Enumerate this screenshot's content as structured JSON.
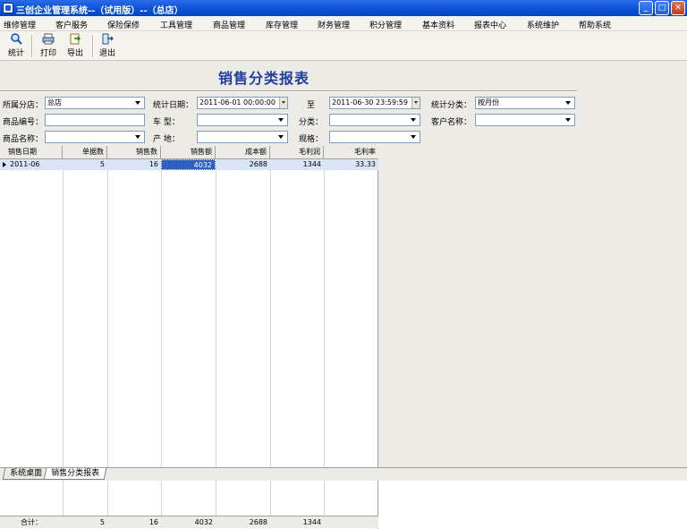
{
  "window": {
    "title": "三创企业管理系统--（试用版）--（总店）",
    "minimize": "_",
    "maximize": "□",
    "close": "✕"
  },
  "menu": [
    "维修管理",
    "客户服务",
    "保险保修",
    "工具管理",
    "商品管理",
    "库存管理",
    "财务管理",
    "积分管理",
    "基本资料",
    "报表中心",
    "系统维护",
    "帮助系统"
  ],
  "toolbar": {
    "stat": "统计",
    "print": "打印",
    "export": "导出",
    "exit": "退出"
  },
  "report": {
    "title": "销售分类报表"
  },
  "filters": {
    "branch_label": "所属分店：",
    "branch_value": "总店",
    "date_label": "统计日期：",
    "date_from": "2011-06-01 00:00:00",
    "to_label": "至",
    "date_to": "2011-06-30 23:59:59",
    "stat_type_label": "统计分类：",
    "stat_type_value": "按月份",
    "product_code_label": "商品编号：",
    "product_code_value": "",
    "car_label": "车    型：",
    "car_value": "",
    "category_label": "分类：",
    "category_value": "",
    "customer_label": "客户名称：",
    "customer_value": "",
    "product_name_label": "商品名称：",
    "product_name_value": "",
    "origin_label": "产    地：",
    "origin_value": "",
    "spec_label": "规格：",
    "spec_value": ""
  },
  "table": {
    "headers": [
      "销售日期",
      "单据数",
      "销售数",
      "销售额",
      "成本额",
      "毛利润",
      "毛利率"
    ],
    "rows": [
      [
        "2011-06",
        "5",
        "16",
        "4032",
        "2688",
        "1344",
        "33.33"
      ]
    ],
    "footer": [
      "合计：",
      "5",
      "16",
      "4032",
      "2688",
      "1344",
      ""
    ]
  },
  "tabs": [
    "系统桌面",
    "销售分类报表"
  ]
}
